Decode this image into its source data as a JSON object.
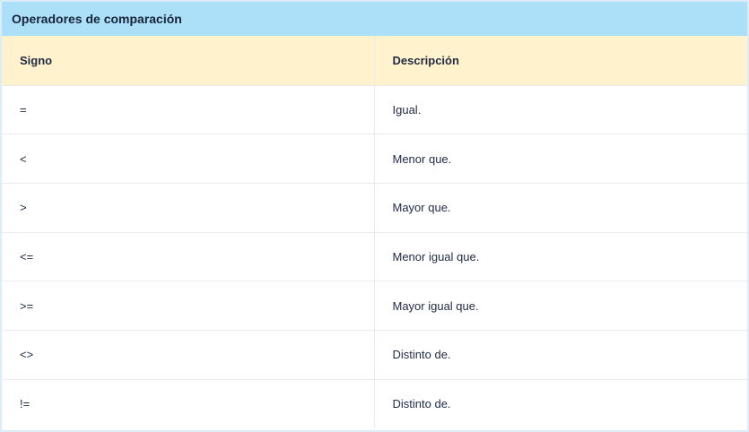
{
  "table": {
    "title": "Operadores de comparación",
    "headers": [
      "Signo",
      "Descripción"
    ],
    "rows": [
      {
        "signo": "=",
        "descripcion": "Igual."
      },
      {
        "signo": "<",
        "descripcion": "Menor que."
      },
      {
        "signo": ">",
        "descripcion": "Mayor que."
      },
      {
        "signo": "<=",
        "descripcion": "Menor igual que."
      },
      {
        "signo": ">=",
        "descripcion": "Mayor igual que."
      },
      {
        "signo": "<>",
        "descripcion": "Distinto de."
      },
      {
        "signo": "!=",
        "descripcion": "Distinto de."
      }
    ]
  },
  "colors": {
    "title_bg": "#abe0f8",
    "header_bg": "#fff2cc",
    "border": "#e9edf1",
    "text": "#1f2a44"
  }
}
